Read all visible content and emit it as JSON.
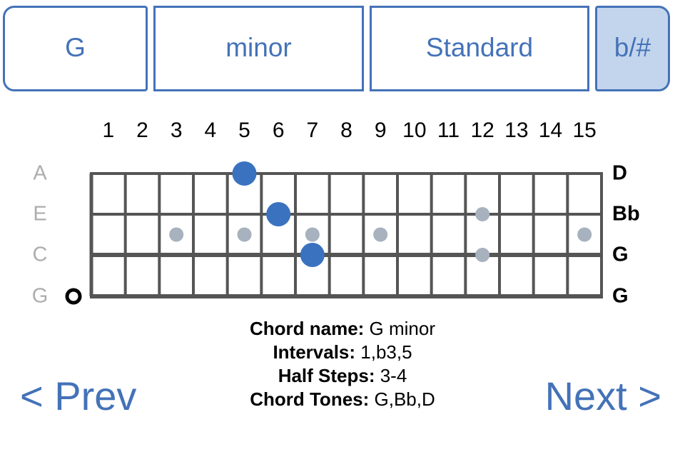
{
  "selector": {
    "buttons": [
      {
        "name": "root-note",
        "label": "G",
        "selected": false
      },
      {
        "name": "quality",
        "label": "minor",
        "selected": false
      },
      {
        "name": "tuning",
        "label": "Standard",
        "selected": false
      },
      {
        "name": "accidental",
        "label": "b/#",
        "selected": true
      }
    ]
  },
  "fretboard": {
    "fret_numbers": [
      "1",
      "2",
      "3",
      "4",
      "5",
      "6",
      "7",
      "8",
      "9",
      "10",
      "11",
      "12",
      "13",
      "14",
      "15"
    ],
    "string_labels_left": [
      "A",
      "E",
      "C",
      "G"
    ],
    "string_labels_right": [
      "D",
      "Bb",
      "G",
      "G"
    ],
    "open_string_markers": [
      {
        "string": "G",
        "string_index": 3,
        "symbol": "open-circle"
      }
    ],
    "fingered_notes": [
      {
        "string": "A",
        "string_index": 0,
        "fret": 5,
        "color": "#3A72BF"
      },
      {
        "string": "E",
        "string_index": 1,
        "fret": 6,
        "color": "#3A72BF"
      },
      {
        "string": "C",
        "string_index": 2,
        "fret": 7,
        "color": "#3A72BF"
      }
    ],
    "inlay_markers": {
      "single_frets": [
        3,
        5,
        7,
        9,
        15
      ],
      "double_frets": [
        12
      ],
      "color": "#A8B2BE"
    },
    "colors": {
      "grid": "#555555",
      "note": "#3A72BF",
      "inlay": "#A8B2BE",
      "label_left": "#ADADAD",
      "label_right": "#000000"
    }
  },
  "info": {
    "rows": [
      {
        "label": "Chord name:",
        "value": "G minor"
      },
      {
        "label": "Intervals:",
        "value": "1,b3,5"
      },
      {
        "label": "Half Steps:",
        "value": "3-4"
      },
      {
        "label": "Chord Tones:",
        "value": "G,Bb,D"
      }
    ]
  },
  "nav": {
    "prev_label": "< Prev",
    "next_label": "Next >"
  },
  "theme": {
    "accent": "#4472B8",
    "accent_fill": "#C3D5ED",
    "note_blue": "#3A72BF",
    "inlay_gray": "#A8B2BE"
  }
}
